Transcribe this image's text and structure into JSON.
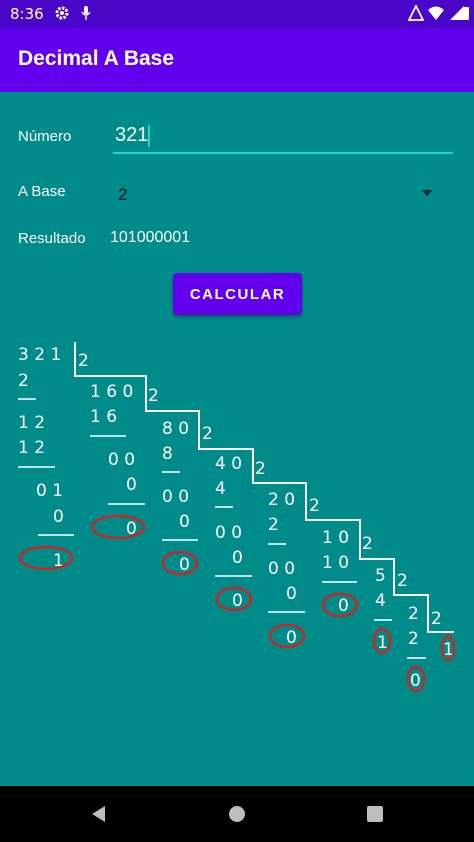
{
  "status_bar": {
    "time": "8:36"
  },
  "app_bar": {
    "title": "Decimal A Base"
  },
  "form": {
    "numero_label": "Número",
    "numero_value": "321",
    "base_label": "A Base",
    "base_value": "2",
    "resultado_label": "Resultado",
    "resultado_value": "101000001",
    "button_label": "CALCULAR"
  },
  "division_image": {
    "dividend": "3 2 1",
    "divisor": "2",
    "steps": [
      {
        "sub": "2",
        "rem1": "1 2",
        "rem1b": "1 2",
        "rem2": "0 1",
        "rem2b": "0",
        "bit": "1",
        "quot": "1 6 0"
      },
      {
        "sub": "1 6",
        "rem1": "0 0",
        "rem1b": "0",
        "bit": "0",
        "quot": "8 0"
      },
      {
        "sub": "8",
        "rem1": "0 0",
        "rem1b": "0",
        "bit": "0",
        "quot": "4 0"
      },
      {
        "sub": "4",
        "rem1": "0 0",
        "rem1b": "0",
        "bit": "0",
        "quot": "2 0"
      },
      {
        "sub": "2",
        "rem1": "0 0",
        "rem1b": "0",
        "bit": "0",
        "quot": "1 0"
      },
      {
        "sub": "1 0",
        "rem1": "0",
        "bit": "0",
        "quot": "5"
      },
      {
        "sub": "4",
        "bit": "1",
        "quot": "2"
      },
      {
        "sub": "2",
        "bit": "0",
        "quot": "1"
      }
    ],
    "ring_color": "#c62828"
  }
}
